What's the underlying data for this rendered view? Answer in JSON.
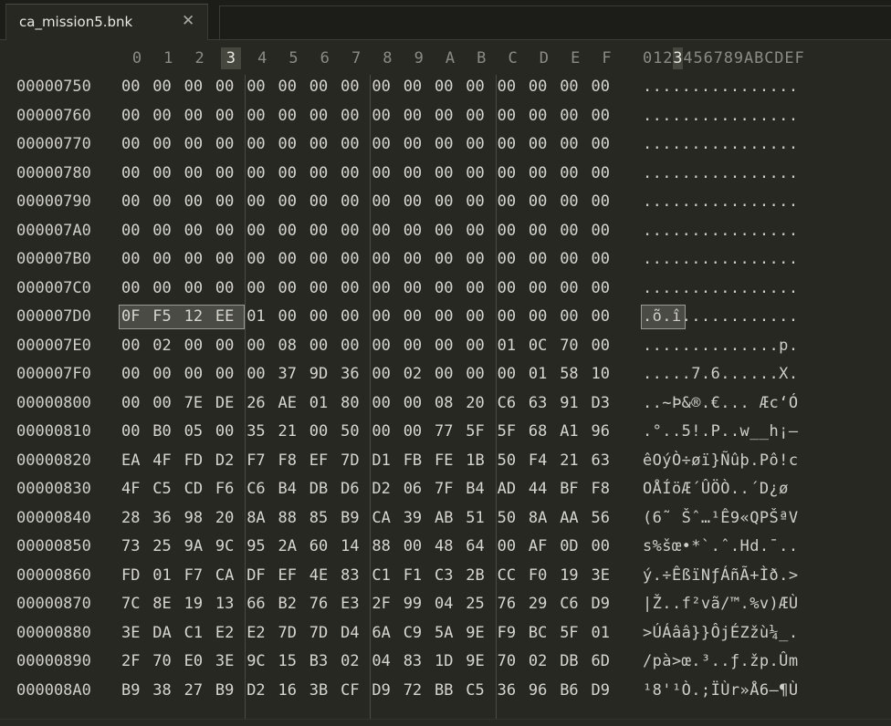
{
  "tab": {
    "title": "ca_mission5.bnk",
    "close_glyph": "✕"
  },
  "header": {
    "hex_columns": [
      "0",
      "1",
      "2",
      "3",
      "4",
      "5",
      "6",
      "7",
      "8",
      "9",
      "A",
      "B",
      "C",
      "D",
      "E",
      "F"
    ],
    "ascii_columns": "0123456789ABCDEF",
    "selected_column": "3"
  },
  "selection": {
    "row_address": "000007D0",
    "bytes": [
      "0F",
      "F5",
      "12",
      "EE"
    ],
    "ascii": ".õ.î"
  },
  "rows": [
    {
      "addr": "00000750",
      "hex": [
        "00",
        "00",
        "00",
        "00",
        "00",
        "00",
        "00",
        "00",
        "00",
        "00",
        "00",
        "00",
        "00",
        "00",
        "00",
        "00"
      ],
      "ascii": "................"
    },
    {
      "addr": "00000760",
      "hex": [
        "00",
        "00",
        "00",
        "00",
        "00",
        "00",
        "00",
        "00",
        "00",
        "00",
        "00",
        "00",
        "00",
        "00",
        "00",
        "00"
      ],
      "ascii": "................"
    },
    {
      "addr": "00000770",
      "hex": [
        "00",
        "00",
        "00",
        "00",
        "00",
        "00",
        "00",
        "00",
        "00",
        "00",
        "00",
        "00",
        "00",
        "00",
        "00",
        "00"
      ],
      "ascii": "................"
    },
    {
      "addr": "00000780",
      "hex": [
        "00",
        "00",
        "00",
        "00",
        "00",
        "00",
        "00",
        "00",
        "00",
        "00",
        "00",
        "00",
        "00",
        "00",
        "00",
        "00"
      ],
      "ascii": "................"
    },
    {
      "addr": "00000790",
      "hex": [
        "00",
        "00",
        "00",
        "00",
        "00",
        "00",
        "00",
        "00",
        "00",
        "00",
        "00",
        "00",
        "00",
        "00",
        "00",
        "00"
      ],
      "ascii": "................"
    },
    {
      "addr": "000007A0",
      "hex": [
        "00",
        "00",
        "00",
        "00",
        "00",
        "00",
        "00",
        "00",
        "00",
        "00",
        "00",
        "00",
        "00",
        "00",
        "00",
        "00"
      ],
      "ascii": "................"
    },
    {
      "addr": "000007B0",
      "hex": [
        "00",
        "00",
        "00",
        "00",
        "00",
        "00",
        "00",
        "00",
        "00",
        "00",
        "00",
        "00",
        "00",
        "00",
        "00",
        "00"
      ],
      "ascii": "................"
    },
    {
      "addr": "000007C0",
      "hex": [
        "00",
        "00",
        "00",
        "00",
        "00",
        "00",
        "00",
        "00",
        "00",
        "00",
        "00",
        "00",
        "00",
        "00",
        "00",
        "00"
      ],
      "ascii": "................"
    },
    {
      "addr": "000007D0",
      "hex": [
        "0F",
        "F5",
        "12",
        "EE",
        "01",
        "00",
        "00",
        "00",
        "00",
        "00",
        "00",
        "00",
        "00",
        "00",
        "00",
        "00"
      ],
      "ascii": ".õ.î............"
    },
    {
      "addr": "000007E0",
      "hex": [
        "00",
        "02",
        "00",
        "00",
        "00",
        "08",
        "00",
        "00",
        "00",
        "00",
        "00",
        "00",
        "01",
        "0C",
        "70",
        "00"
      ],
      "ascii": "..............p."
    },
    {
      "addr": "000007F0",
      "hex": [
        "00",
        "00",
        "00",
        "00",
        "00",
        "37",
        "9D",
        "36",
        "00",
        "02",
        "00",
        "00",
        "00",
        "01",
        "58",
        "10"
      ],
      "ascii": ".....7.6......X."
    },
    {
      "addr": "00000800",
      "hex": [
        "00",
        "00",
        "7E",
        "DE",
        "26",
        "AE",
        "01",
        "80",
        "00",
        "00",
        "08",
        "20",
        "C6",
        "63",
        "91",
        "D3"
      ],
      "ascii": "..~Þ&®.€... Æc‘Ó"
    },
    {
      "addr": "00000810",
      "hex": [
        "00",
        "B0",
        "05",
        "00",
        "35",
        "21",
        "00",
        "50",
        "00",
        "00",
        "77",
        "5F",
        "5F",
        "68",
        "A1",
        "96"
      ],
      "ascii": ".°..5!.P..w__h¡–"
    },
    {
      "addr": "00000820",
      "hex": [
        "EA",
        "4F",
        "FD",
        "D2",
        "F7",
        "F8",
        "EF",
        "7D",
        "D1",
        "FB",
        "FE",
        "1B",
        "50",
        "F4",
        "21",
        "63"
      ],
      "ascii": "êOýÒ÷øï}Ñûþ.Pô!c"
    },
    {
      "addr": "00000830",
      "hex": [
        "4F",
        "C5",
        "CD",
        "F6",
        "C6",
        "B4",
        "DB",
        "D6",
        "D2",
        "06",
        "7F",
        "B4",
        "AD",
        "44",
        "BF",
        "F8"
      ],
      "ascii": "OÅÍöÆ´ÛÖÒ..´­D¿ø"
    },
    {
      "addr": "00000840",
      "hex": [
        "28",
        "36",
        "98",
        "20",
        "8A",
        "88",
        "85",
        "B9",
        "CA",
        "39",
        "AB",
        "51",
        "50",
        "8A",
        "AA",
        "56"
      ],
      "ascii": "(6˜ Šˆ…¹Ê9«QPŠªV"
    },
    {
      "addr": "00000850",
      "hex": [
        "73",
        "25",
        "9A",
        "9C",
        "95",
        "2A",
        "60",
        "14",
        "88",
        "00",
        "48",
        "64",
        "00",
        "AF",
        "0D",
        "00"
      ],
      "ascii": "s%šœ•*`.ˆ.Hd.¯.."
    },
    {
      "addr": "00000860",
      "hex": [
        "FD",
        "01",
        "F7",
        "CA",
        "DF",
        "EF",
        "4E",
        "83",
        "C1",
        "F1",
        "C3",
        "2B",
        "CC",
        "F0",
        "19",
        "3E"
      ],
      "ascii": "ý.÷ÊßïNƒÁñÃ+Ìð.>"
    },
    {
      "addr": "00000870",
      "hex": [
        "7C",
        "8E",
        "19",
        "13",
        "66",
        "B2",
        "76",
        "E3",
        "2F",
        "99",
        "04",
        "25",
        "76",
        "29",
        "C6",
        "D9"
      ],
      "ascii": "|Ž..f²vã/™.%v)ÆÙ"
    },
    {
      "addr": "00000880",
      "hex": [
        "3E",
        "DA",
        "C1",
        "E2",
        "E2",
        "7D",
        "7D",
        "D4",
        "6A",
        "C9",
        "5A",
        "9E",
        "F9",
        "BC",
        "5F",
        "01"
      ],
      "ascii": ">ÚÁââ}}ÔjÉZžù¼_."
    },
    {
      "addr": "00000890",
      "hex": [
        "2F",
        "70",
        "E0",
        "3E",
        "9C",
        "15",
        "B3",
        "02",
        "04",
        "83",
        "1D",
        "9E",
        "70",
        "02",
        "DB",
        "6D"
      ],
      "ascii": "/pà>œ.³..ƒ.žp.Ûm"
    },
    {
      "addr": "000008A0",
      "hex": [
        "B9",
        "38",
        "27",
        "B9",
        "D2",
        "16",
        "3B",
        "CF",
        "D9",
        "72",
        "BB",
        "C5",
        "36",
        "96",
        "B6",
        "D9"
      ],
      "ascii": "¹8'¹Ò.;ÏÙr»Å6–¶Ù"
    }
  ]
}
